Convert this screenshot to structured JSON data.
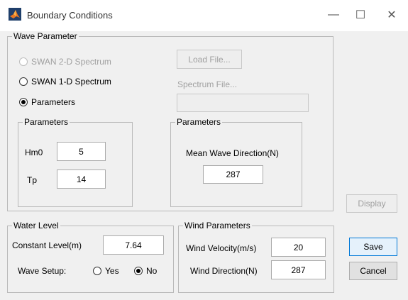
{
  "window": {
    "title": "Boundary Conditions",
    "controls": {
      "minimize": "—",
      "maximize": "☐",
      "close": "✕"
    }
  },
  "wave_parameter": {
    "legend": "Wave Parameter",
    "options": {
      "swan_2d": {
        "label": "SWAN 2-D Spectrum",
        "enabled": false,
        "selected": false
      },
      "swan_1d": {
        "label": "SWAN 1-D Spectrum",
        "enabled": true,
        "selected": false
      },
      "parameters": {
        "label": "Parameters",
        "enabled": true,
        "selected": true
      }
    },
    "load_file_button": "Load File...",
    "spectrum_file_label": "Spectrum File...",
    "spectrum_file_value": "",
    "params_box": {
      "legend": "Parameters",
      "hm0_label": "Hm0",
      "hm0_value": "5",
      "tp_label": "Tp",
      "tp_value": "14"
    },
    "direction_box": {
      "legend": "Parameters",
      "mean_dir_label": "Mean Wave Direction(N)",
      "mean_dir_value": "287"
    }
  },
  "display_button": "Display",
  "water_level": {
    "legend": "Water Level",
    "constant_label": "Constant Level(m)",
    "constant_value": "7.64",
    "setup_label": "Wave Setup:",
    "yes_label": "Yes",
    "no_label": "No",
    "setup_selected": "No"
  },
  "wind": {
    "legend": "Wind Parameters",
    "velocity_label": "Wind Velocity(m/s)",
    "velocity_value": "20",
    "direction_label": "Wind Direction(N)",
    "direction_value": "287"
  },
  "save_button": "Save",
  "cancel_button": "Cancel",
  "colors": {
    "dialog_bg": "#f0f0f0",
    "icon_orange": "#e87722",
    "focus_blue": "#0078d7"
  }
}
